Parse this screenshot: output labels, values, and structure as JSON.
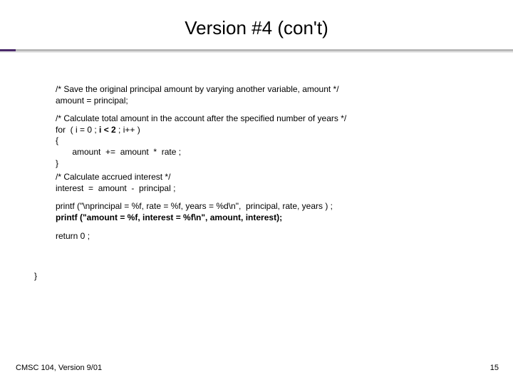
{
  "title": "Version #4 (con't)",
  "code": {
    "c1": "/* Save the original principal amount by varying another variable, amount */",
    "c2": "amount = principal;",
    "c3": "/* Calculate total amount in the account after the specified number of years */",
    "c4_pre": "for  ( i = 0 ; ",
    "c4_bold": "i < 2",
    "c4_post": " ; i++ )",
    "c5": "{",
    "c6": "       amount  +=  amount  *  rate ;",
    "c7": "}",
    "c8": "/* Calculate accrued interest */",
    "c9": "interest  =  amount  -  principal ;",
    "c10": "printf (\"\\nprincipal = %f, rate = %f, years = %d\\n\",  principal, rate, years ) ;",
    "c11": "printf (\"amount = %f, interest = %f\\n\", amount, interest);",
    "c12": "return 0 ;",
    "c13": "}"
  },
  "footer": {
    "left": "CMSC 104, Version 9/01",
    "right": "15"
  }
}
